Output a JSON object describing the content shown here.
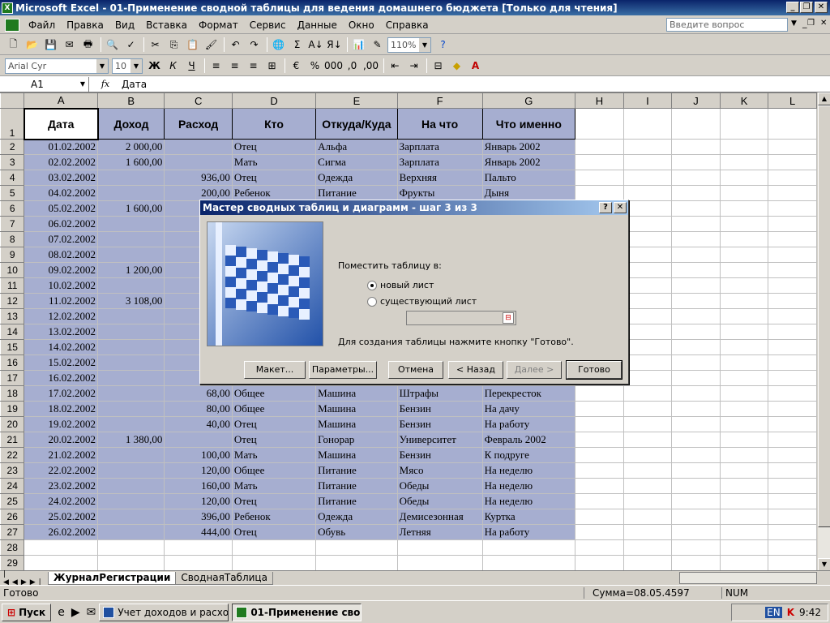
{
  "window": {
    "title": "Microsoft Excel - 01-Применение сводной таблицы для ведения домашнего бюджета  [Только для чтения]"
  },
  "menu": {
    "items": [
      "Файл",
      "Правка",
      "Вид",
      "Вставка",
      "Формат",
      "Сервис",
      "Данные",
      "Окно",
      "Справка"
    ],
    "help_placeholder": "Введите вопрос"
  },
  "toolbar": {
    "zoom": "110%",
    "font": "Arial Cyr",
    "size": "10"
  },
  "formula": {
    "cell": "A1",
    "fx": "fx",
    "content": "Дата"
  },
  "sheet": {
    "columns": [
      "A",
      "B",
      "C",
      "D",
      "E",
      "F",
      "G",
      "H",
      "I",
      "J",
      "K",
      "L"
    ],
    "header_row": [
      "Дата",
      "Доход",
      "Расход",
      "Кто",
      "Откуда/Куда",
      "На что",
      "Что именно"
    ],
    "rows": [
      [
        "01.02.2002",
        "2 000,00",
        "",
        "Отец",
        "Альфа",
        "Зарплата",
        "Январь 2002"
      ],
      [
        "02.02.2002",
        "1 600,00",
        "",
        "Мать",
        "Сигма",
        "Зарплата",
        "Январь 2002"
      ],
      [
        "03.02.2002",
        "",
        "936,00",
        "Отец",
        "Одежда",
        "Верхняя",
        "Пальто"
      ],
      [
        "04.02.2002",
        "",
        "200,00",
        "Ребенок",
        "Питание",
        "Фрукты",
        "Дыня"
      ],
      [
        "05.02.2002",
        "1 600,00",
        "",
        "",
        "",
        "",
        ""
      ],
      [
        "06.02.2002",
        "",
        "",
        "",
        "",
        "",
        ""
      ],
      [
        "07.02.2002",
        "",
        "",
        "",
        "",
        "",
        ""
      ],
      [
        "08.02.2002",
        "",
        "",
        "",
        "",
        "",
        ""
      ],
      [
        "09.02.2002",
        "1 200,00",
        "",
        "",
        "",
        "",
        ""
      ],
      [
        "10.02.2002",
        "",
        "",
        "",
        "",
        "",
        ""
      ],
      [
        "11.02.2002",
        "3 108,00",
        "",
        "",
        "",
        "",
        ""
      ],
      [
        "12.02.2002",
        "",
        "",
        "",
        "",
        "",
        ""
      ],
      [
        "13.02.2002",
        "",
        "",
        "",
        "",
        "",
        ""
      ],
      [
        "14.02.2002",
        "",
        "",
        "",
        "",
        "",
        ""
      ],
      [
        "15.02.2002",
        "",
        "",
        "",
        "",
        "",
        ""
      ],
      [
        "16.02.2002",
        "",
        "",
        "",
        "",
        "",
        ""
      ],
      [
        "17.02.2002",
        "",
        "68,00",
        "Общее",
        "Машина",
        "Штрафы",
        "Перекресток"
      ],
      [
        "18.02.2002",
        "",
        "80,00",
        "Общее",
        "Машина",
        "Бензин",
        "На дачу"
      ],
      [
        "19.02.2002",
        "",
        "40,00",
        "Отец",
        "Машина",
        "Бензин",
        "На работу"
      ],
      [
        "20.02.2002",
        "1 380,00",
        "",
        "Отец",
        "Гонорар",
        "Университет",
        "Февраль 2002"
      ],
      [
        "21.02.2002",
        "",
        "100,00",
        "Мать",
        "Машина",
        "Бензин",
        "К подруге"
      ],
      [
        "22.02.2002",
        "",
        "120,00",
        "Общее",
        "Питание",
        "Мясо",
        "На неделю"
      ],
      [
        "23.02.2002",
        "",
        "160,00",
        "Мать",
        "Питание",
        "Обеды",
        "На неделю"
      ],
      [
        "24.02.2002",
        "",
        "120,00",
        "Отец",
        "Питание",
        "Обеды",
        "На неделю"
      ],
      [
        "25.02.2002",
        "",
        "396,00",
        "Ребенок",
        "Одежда",
        "Демисезонная",
        "Куртка"
      ],
      [
        "26.02.2002",
        "",
        "444,00",
        "Отец",
        "Обувь",
        "Летняя",
        "На работу"
      ]
    ],
    "row_numbers": [
      "1",
      "2",
      "3",
      "4",
      "5",
      "6",
      "7",
      "8",
      "9",
      "10",
      "11",
      "12",
      "13",
      "14",
      "15",
      "16",
      "17",
      "18",
      "19",
      "20",
      "21",
      "22",
      "23",
      "24",
      "25",
      "26",
      "27",
      "28",
      "29"
    ],
    "tabs": [
      "ЖурналРегистрации",
      "СводнаяТаблица"
    ]
  },
  "dialog": {
    "title": "Мастер сводных таблиц и диаграмм - шаг 3 из 3",
    "prompt": "Поместить таблицу в:",
    "option_new": "новый лист",
    "option_existing": "существующий лист",
    "hint": "Для создания таблицы нажмите кнопку \"Готово\".",
    "buttons": {
      "layout": "Макет...",
      "params": "Параметры...",
      "cancel": "Отмена",
      "back": "< Назад",
      "next": "Далее >",
      "finish": "Готово"
    }
  },
  "status": {
    "ready": "Готово",
    "sum": "Сумма=08.05.4597",
    "num": "NUM"
  },
  "taskbar": {
    "start": "Пуск",
    "task1": "Учет доходов и расход...",
    "task2": "01-Применение свод...",
    "lang": "EN",
    "time": "9:42"
  }
}
